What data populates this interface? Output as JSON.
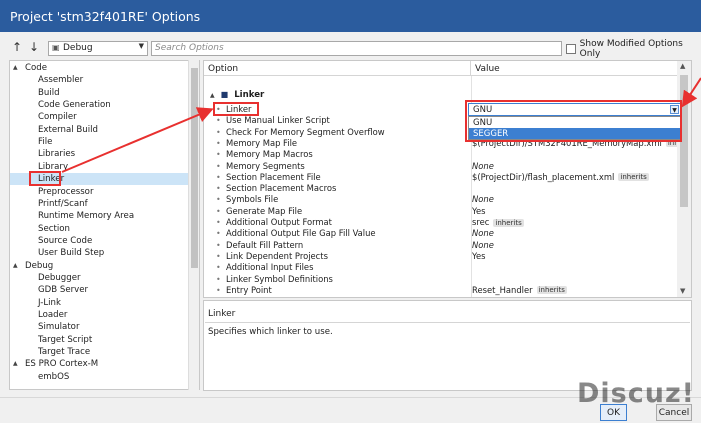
{
  "window": {
    "title": "Project 'stm32f401RE' Options"
  },
  "toolbar": {
    "up_icon": "arrow-up-icon",
    "down_icon": "arrow-down-icon",
    "config_value": "Debug",
    "search_placeholder": "Search Options",
    "show_modified_label": "Show Modified Options Only"
  },
  "tree": {
    "items": [
      {
        "label": "Code",
        "level": 0,
        "expanded": true
      },
      {
        "label": "Assembler",
        "level": 1
      },
      {
        "label": "Build",
        "level": 1
      },
      {
        "label": "Code Generation",
        "level": 1
      },
      {
        "label": "Compiler",
        "level": 1
      },
      {
        "label": "External Build",
        "level": 1
      },
      {
        "label": "File",
        "level": 1
      },
      {
        "label": "Libraries",
        "level": 1
      },
      {
        "label": "Library",
        "level": 1
      },
      {
        "label": "Linker",
        "level": 1,
        "selected": true
      },
      {
        "label": "Preprocessor",
        "level": 1
      },
      {
        "label": "Printf/Scanf",
        "level": 1
      },
      {
        "label": "Runtime Memory Area",
        "level": 1
      },
      {
        "label": "Section",
        "level": 1
      },
      {
        "label": "Source Code",
        "level": 1
      },
      {
        "label": "User Build Step",
        "level": 1
      },
      {
        "label": "Debug",
        "level": 0,
        "expanded": true
      },
      {
        "label": "Debugger",
        "level": 1
      },
      {
        "label": "GDB Server",
        "level": 1
      },
      {
        "label": "J-Link",
        "level": 1
      },
      {
        "label": "Loader",
        "level": 1
      },
      {
        "label": "Simulator",
        "level": 1
      },
      {
        "label": "Target Script",
        "level": 1
      },
      {
        "label": "Target Trace",
        "level": 1
      },
      {
        "label": "ES PRO Cortex-M",
        "level": 0,
        "expanded": true
      },
      {
        "label": "embOS",
        "level": 1
      }
    ]
  },
  "grid": {
    "col_option": "Option",
    "col_value": "Value",
    "category": "Linker",
    "rows": [
      {
        "name": "Linker",
        "value": ""
      },
      {
        "name": "Use Manual Linker Script",
        "value": ""
      },
      {
        "name": "Check For Memory Segment Overflow",
        "value": ""
      },
      {
        "name": "Memory Map File",
        "value": "$(ProjectDir)/STM32F401RE_MemoryMap.xml",
        "badge": "inherits"
      },
      {
        "name": "Memory Map Macros",
        "value": ""
      },
      {
        "name": "Memory Segments",
        "value": "None",
        "italic": true
      },
      {
        "name": "Section Placement File",
        "value": "$(ProjectDir)/flash_placement.xml",
        "badge": "inherits"
      },
      {
        "name": "Section Placement Macros",
        "value": ""
      },
      {
        "name": "Symbols File",
        "value": "None",
        "italic": true
      },
      {
        "name": "Generate Map File",
        "value": "Yes"
      },
      {
        "name": "Additional Output Format",
        "value": "srec",
        "badge": "inherits"
      },
      {
        "name": "Additional Output File Gap Fill Value",
        "value": "None",
        "italic": true
      },
      {
        "name": "Default Fill Pattern",
        "value": "None",
        "italic": true
      },
      {
        "name": "Link Dependent Projects",
        "value": "Yes"
      },
      {
        "name": "Additional Input Files",
        "value": ""
      },
      {
        "name": "Linker Symbol Definitions",
        "value": ""
      },
      {
        "name": "Entry Point",
        "value": "Reset_Handler",
        "badge": "inherits"
      }
    ]
  },
  "linker_dropdown": {
    "selected": "GNU",
    "options": [
      "GNU",
      "SEGGER"
    ],
    "highlighted": "SEGGER"
  },
  "description": {
    "title": "Linker",
    "text": "Specifies which linker to use."
  },
  "buttons": {
    "ok": "OK",
    "cancel": "Cancel"
  },
  "watermark": "Discuz!",
  "colors": {
    "titlebar": "#2b5c9e",
    "accent": "#3c7fd1",
    "annotation_red": "#e8302f",
    "selection": "#cce4f7"
  }
}
